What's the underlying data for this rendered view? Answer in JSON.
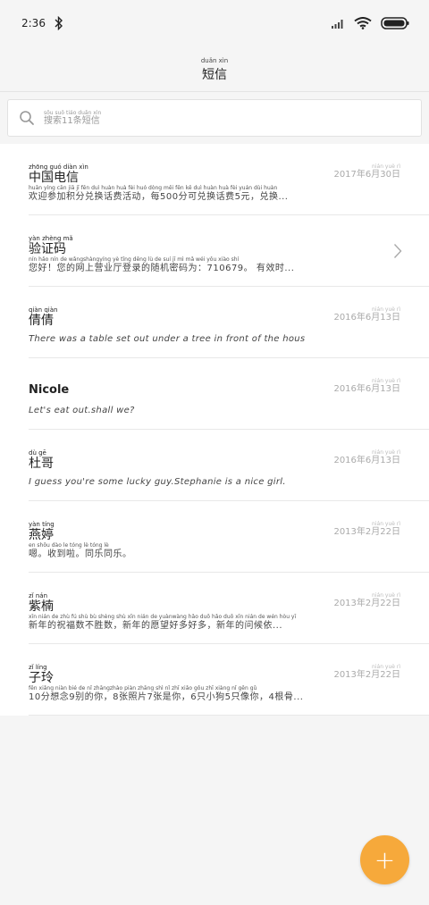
{
  "status": {
    "time": "2:36"
  },
  "header": {
    "pinyin": "duǎn xìn",
    "title": "短信"
  },
  "search": {
    "pinyin": "sōu suǒ      tiáo duǎn xìn",
    "placeholder": "搜索11条短信"
  },
  "messages": [
    {
      "name_pinyin": "zhōng guó diàn xìn",
      "name": "中国电信",
      "date_pinyin": "nián  yuè    rì",
      "date": "2017年6月30日",
      "preview_pinyin": "huān yíng cān jiā  jī   fēn duì huàn huà  fèi  huó dòng  měi      fēn kě  duì huàn huà  fèi  yuán  dùi huàn",
      "preview": "欢迎参加积分兑换话费活动，每500分可兑换话费5元，兑换..."
    },
    {
      "name_pinyin": "yàn zhèng mǎ",
      "name": "验证码",
      "date_pinyin": "",
      "date": "",
      "preview_pinyin": "nín hǎo  nín de wǎngshàngyíng yè tīng dēng lù de suí  jī  mì  mǎ wéi                yǒu xiào shí",
      "preview": "您好！您的网上营业厅登录的随机密码为：710679。 有效时..."
    },
    {
      "name_pinyin": "qiàn qiàn",
      "name": "倩倩",
      "date_pinyin": "nián  yuè    rì",
      "date": "2016年6月13日",
      "preview_pinyin": "",
      "preview": "There was a table set out under a tree in front of the hous"
    },
    {
      "name_pinyin": "",
      "name": "Nicole",
      "date_pinyin": "nián  yuè    rì",
      "date": "2016年6月13日",
      "preview_pinyin": "",
      "preview": "Let's eat out.shall we?"
    },
    {
      "name_pinyin": "dù  gē",
      "name": "杜哥",
      "date_pinyin": "nián  yuè    rì",
      "date": "2016年6月13日",
      "preview_pinyin": "",
      "preview": "I guess you're some lucky guy.Stephanie is a nice girl."
    },
    {
      "name_pinyin": "yàn tíng",
      "name": "燕婷",
      "date_pinyin": "nián  yuè    rì",
      "date": "2013年2月22日",
      "preview_pinyin": "en     shōu dào  le       tóng  lè  tóng  lè",
      "preview": "嗯。收到啦。同乐同乐。"
    },
    {
      "name_pinyin": "zǐ  nán",
      "name": "紫楠",
      "date_pinyin": "nián  yuè    rì",
      "date": "2013年2月22日",
      "preview_pinyin": "xīn nián de zhù  fú  shù bù shèng shù    xīn nián de yuànwàng hǎo duō hǎo duō     xīn nián de wén hòu yī",
      "preview": "新年的祝福数不胜数，新年的愿望好多好多，新年的问候依..."
    },
    {
      "name_pinyin": "zǐ  líng",
      "name": "子玲",
      "date_pinyin": "nián  yuè    rì",
      "date": "2013年2月22日",
      "preview_pinyin": "fēn xiǎng niàn   bié  de  nǐ      zhāngzhào piàn  zhāng shì  nǐ        zhī xiǎo gǒu   zhī xiàng nǐ     gēn gǔ",
      "preview": "10分想念9别的你，8张照片7张是你，6只小狗5只像你，4根骨..."
    }
  ],
  "icons": {
    "search": "search-icon",
    "chevron": "chevron-right-icon",
    "add": "add-icon",
    "bluetooth": "bluetooth-icon",
    "signal": "signal-icon",
    "wifi": "wifi-icon",
    "battery": "battery-icon"
  },
  "colors": {
    "fab": "#f6a93b"
  }
}
